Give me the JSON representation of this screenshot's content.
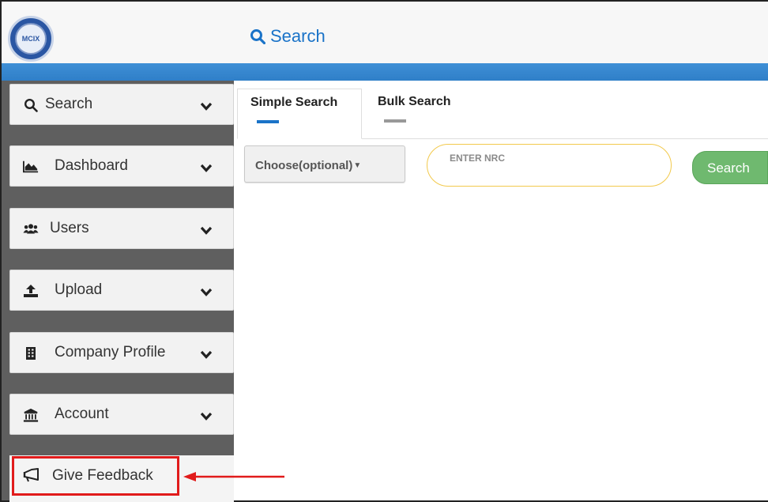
{
  "header": {
    "logo_text": "MCIX",
    "title": "Search"
  },
  "sidebar": {
    "items": [
      {
        "label": "Search",
        "icon": "search-icon"
      },
      {
        "label": "Dashboard",
        "icon": "area-chart-icon"
      },
      {
        "label": "Users",
        "icon": "users-icon"
      },
      {
        "label": "Upload",
        "icon": "upload-icon"
      },
      {
        "label": "Company Profile",
        "icon": "building-icon"
      },
      {
        "label": "Account",
        "icon": "bank-icon"
      }
    ],
    "feedback": {
      "label": "Give Feedback",
      "icon": "megaphone-icon"
    }
  },
  "tabs": [
    {
      "label": "Simple Search",
      "active": true
    },
    {
      "label": "Bulk Search",
      "active": false
    }
  ],
  "search_form": {
    "select_value": "Choose(optional)",
    "nrc_placeholder": "ENTER NRC",
    "nrc_value": "",
    "button_label": "Search"
  },
  "colors": {
    "accent": "#1a73c8",
    "sidebar_bg": "#5f5f5f",
    "button_green": "#6fb96f",
    "input_border": "#f2c94c",
    "annotation_red": "#e11b1b"
  }
}
